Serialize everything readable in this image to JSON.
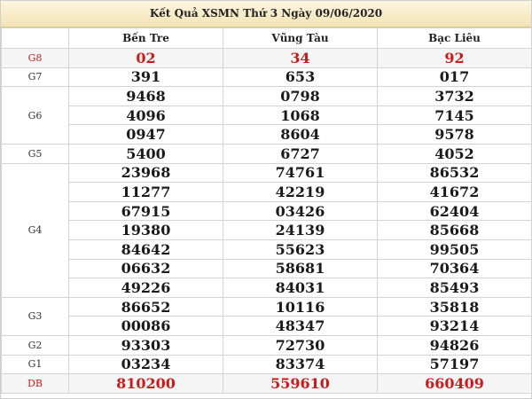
{
  "title": "Kết Quả XSMN Thứ 3 Ngày 09/06/2020",
  "provinces": [
    "Bến Tre",
    "Vũng Tàu",
    "Bạc Liêu"
  ],
  "prizes": {
    "g8": {
      "label": "G8",
      "rows": [
        [
          "02",
          "34",
          "92"
        ]
      ]
    },
    "g7": {
      "label": "G7",
      "rows": [
        [
          "391",
          "653",
          "017"
        ]
      ]
    },
    "g6": {
      "label": "G6",
      "rows": [
        [
          "9468",
          "0798",
          "3732"
        ],
        [
          "4096",
          "1068",
          "7145"
        ],
        [
          "0947",
          "8604",
          "9578"
        ]
      ]
    },
    "g5": {
      "label": "G5",
      "rows": [
        [
          "5400",
          "6727",
          "4052"
        ]
      ]
    },
    "g4": {
      "label": "G4",
      "rows": [
        [
          "23968",
          "74761",
          "86532"
        ],
        [
          "11277",
          "42219",
          "41672"
        ],
        [
          "67915",
          "03426",
          "62404"
        ],
        [
          "19380",
          "24139",
          "85668"
        ],
        [
          "84642",
          "55623",
          "99505"
        ],
        [
          "06632",
          "58681",
          "70364"
        ],
        [
          "49226",
          "84031",
          "85493"
        ]
      ]
    },
    "g3": {
      "label": "G3",
      "rows": [
        [
          "86652",
          "10116",
          "35818"
        ],
        [
          "00086",
          "48347",
          "93214"
        ]
      ]
    },
    "g2": {
      "label": "G2",
      "rows": [
        [
          "93303",
          "72730",
          "94826"
        ]
      ]
    },
    "g1": {
      "label": "G1",
      "rows": [
        [
          "03234",
          "83374",
          "57197"
        ]
      ]
    },
    "db": {
      "label": "DB",
      "rows": [
        [
          "810200",
          "559610",
          "660409"
        ]
      ]
    }
  },
  "colors": {
    "highlight": "#cc1a1a",
    "header_bg": "#f3e4b4"
  }
}
